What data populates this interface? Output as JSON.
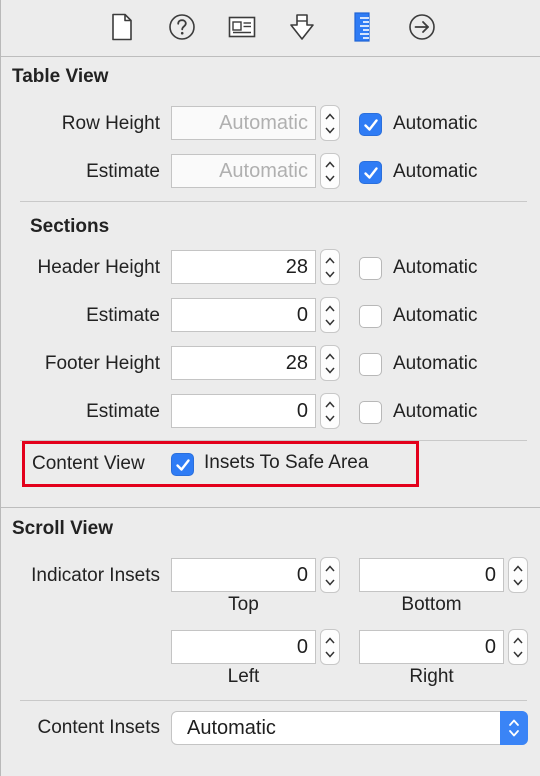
{
  "tabs": [
    {
      "icon": "file-icon"
    },
    {
      "icon": "help-icon"
    },
    {
      "icon": "identity-icon"
    },
    {
      "icon": "attributes-icon"
    },
    {
      "icon": "size-ruler-icon",
      "selected": true
    },
    {
      "icon": "connections-icon"
    }
  ],
  "accent_color": "#2f7cf5",
  "highlight_color": "#e3001b",
  "table_view": {
    "title": "Table View",
    "row_height": {
      "label": "Row Height",
      "placeholder": "Automatic",
      "automatic_label": "Automatic",
      "automatic_checked": true
    },
    "estimate": {
      "label": "Estimate",
      "placeholder": "Automatic",
      "automatic_label": "Automatic",
      "automatic_checked": true
    }
  },
  "sections": {
    "title": "Sections",
    "header_height": {
      "label": "Header Height",
      "value": "28",
      "automatic_label": "Automatic",
      "automatic_checked": false
    },
    "header_estimate": {
      "label": "Estimate",
      "value": "0",
      "automatic_label": "Automatic",
      "automatic_checked": false
    },
    "footer_height": {
      "label": "Footer Height",
      "value": "28",
      "automatic_label": "Automatic",
      "automatic_checked": false
    },
    "footer_estimate": {
      "label": "Estimate",
      "value": "0",
      "automatic_label": "Automatic",
      "automatic_checked": false
    }
  },
  "content_view": {
    "label": "Content View",
    "insets_label": "Insets To Safe Area",
    "insets_checked": true
  },
  "scroll_view": {
    "title": "Scroll View",
    "indicator_insets": {
      "label": "Indicator Insets",
      "top": {
        "value": "0",
        "label": "Top"
      },
      "bottom": {
        "value": "0",
        "label": "Bottom"
      },
      "left": {
        "value": "0",
        "label": "Left"
      },
      "right": {
        "value": "0",
        "label": "Right"
      }
    },
    "content_insets": {
      "label": "Content Insets",
      "value": "Automatic"
    }
  }
}
